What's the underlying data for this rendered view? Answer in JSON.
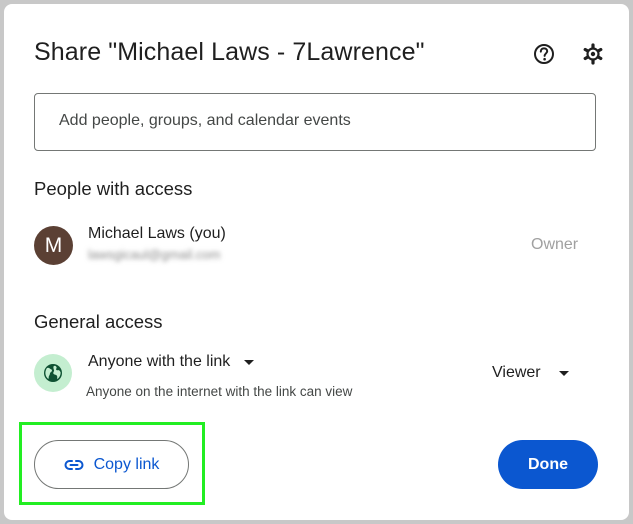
{
  "dialog": {
    "title": "Share \"Michael Laws - 7Lawrence\"",
    "help_icon": "help-circle-icon",
    "settings_icon": "gear-icon"
  },
  "search": {
    "placeholder": "Add people, groups, and calendar events",
    "value": ""
  },
  "people_section": {
    "heading": "People with access",
    "people": [
      {
        "avatar_letter": "M",
        "name": "Michael Laws (you)",
        "email": "lawsgicaul@gmail.com",
        "role": "Owner"
      }
    ]
  },
  "general_access": {
    "heading": "General access",
    "icon": "globe-icon",
    "access_label": "Anyone with the link",
    "description": "Anyone on the internet with the link can view",
    "role": "Viewer"
  },
  "footer": {
    "copy_link_label": "Copy link",
    "copy_link_icon": "link-icon",
    "done_label": "Done"
  },
  "colors": {
    "accent": "#0b57d0",
    "highlight": "#22ee22",
    "avatar_bg": "#5b4034",
    "globe_bg": "#c4eed0"
  }
}
